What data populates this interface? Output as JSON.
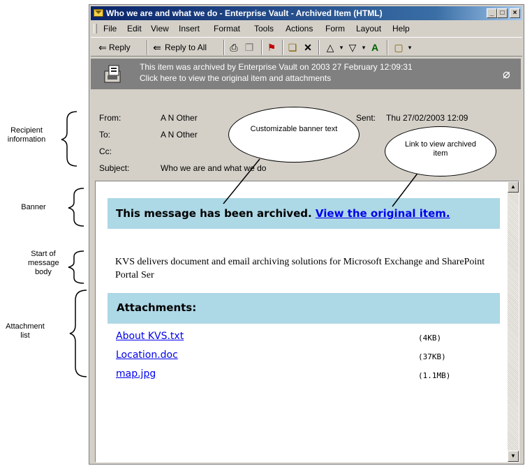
{
  "window": {
    "title": "Who we are and what we do - Enterprise Vault - Archived Item (HTML)",
    "controls": [
      "_",
      "□",
      "×"
    ]
  },
  "menu": [
    "File",
    "Edit",
    "View",
    "Insert",
    "Format",
    "Tools",
    "Actions",
    "Form",
    "Layout",
    "Help"
  ],
  "toolbar": {
    "reply": "Reply",
    "reply_all": "Reply to All",
    "icons": [
      "reply-icon",
      "reply-all-icon",
      "print-icon",
      "copy-icon",
      "flag-icon",
      "move-icon",
      "delete-icon",
      "previous-icon",
      "next-icon",
      "address-book-icon",
      "options-icon"
    ]
  },
  "archive_notice": {
    "line1": "This item was archived by Enterprise Vault on 2003 27 February 12:09:31",
    "line2": "Click here to view the original item and attachments"
  },
  "header": {
    "from_label": "From:",
    "from": "A N Other",
    "to_label": "To:",
    "to": "A N Other",
    "cc_label": "Cc:",
    "cc": "",
    "subject_label": "Subject:",
    "subject": "Who we are and what we do",
    "sent_label": "Sent:",
    "sent": "Thu 27/02/2003 12:09"
  },
  "banner": {
    "text": "This message has been archived.",
    "link": "View the original item."
  },
  "body_text": "KVS delivers document and email archiving solutions for Microsoft Exchange and SharePoint Portal Ser",
  "attachments": {
    "heading": "Attachments:",
    "items": [
      {
        "name": "About KVS.txt",
        "size": "(4KB)"
      },
      {
        "name": "Location.doc",
        "size": "(37KB)"
      },
      {
        "name": "map.jpg",
        "size": "(1.1MB)"
      }
    ]
  },
  "annotations": {
    "recipient": "Recipient information",
    "banner": "Banner",
    "start": "Start of message body",
    "attachment": "Attachment list",
    "callout_banner": "Customizable banner text",
    "callout_link": "Link to view archived item"
  }
}
